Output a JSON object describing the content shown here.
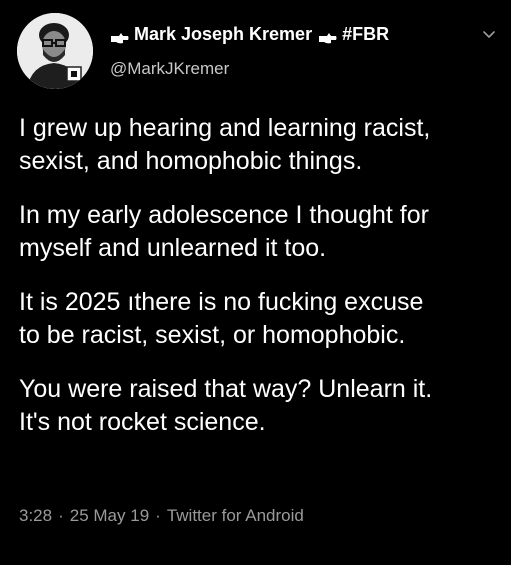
{
  "colors": {
    "background": "#000000",
    "text_primary": "#ffffff",
    "text_secondary": "#9a9a9a"
  },
  "author": {
    "display_name": "Mark Joseph Kremer",
    "name_suffix": "#FBR",
    "name_glyph_icon": "pointing-hand-emoji-icon",
    "handle": "@MarkJKremer",
    "avatar_icon": "profile-photo-avatar"
  },
  "tweet": {
    "paragraphs": [
      "I grew up hearing and learning racist,\nsexist, and homophobic things.",
      "In my early adolescence I thought for\nmyself and unlearned it too.",
      "It is 2025 ıthere is no fucking excuse\nto be racist, sexist, or homophobic.",
      "You were raised that way? Unlearn it.\nIt's not rocket science."
    ]
  },
  "meta": {
    "time": "3:28",
    "date": "25 May 19",
    "source": "Twitter for Android",
    "separator": "·"
  },
  "menu": {
    "icon": "chevron-down-icon"
  }
}
